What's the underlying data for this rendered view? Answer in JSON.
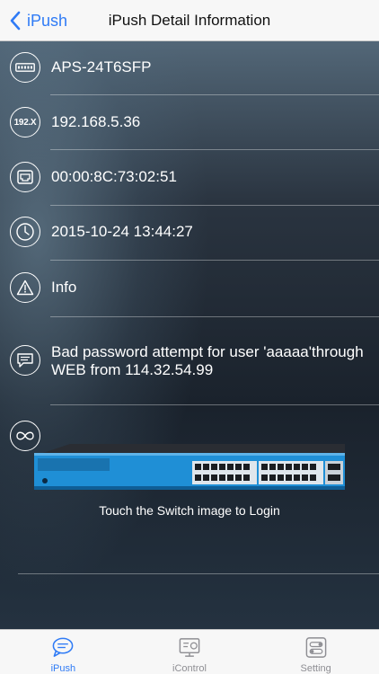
{
  "nav": {
    "back_label": "iPush",
    "title": "iPush Detail Information"
  },
  "details": {
    "model": "APS-24T6SFP",
    "ip_icon_text": "192.X",
    "ip": "192.168.5.36",
    "mac": "00:00:8C:73:02:51",
    "datetime": "2015-10-24 13:44:27",
    "level": "Info",
    "message": "Bad password attempt for user 'aaaaa'through WEB from 114.32.54.99"
  },
  "switch": {
    "login_hint": "Touch the Switch image to Login"
  },
  "tabs": [
    {
      "label": "iPush",
      "icon": "chat-bubble-icon",
      "active": true
    },
    {
      "label": "iControl",
      "icon": "control-panel-icon",
      "active": false
    },
    {
      "label": "Setting",
      "icon": "toggle-settings-icon",
      "active": false
    }
  ],
  "colors": {
    "accent": "#2f7bf6",
    "navbar_bg": "#f7f7f7",
    "inactive_tab": "#8e8e93"
  }
}
